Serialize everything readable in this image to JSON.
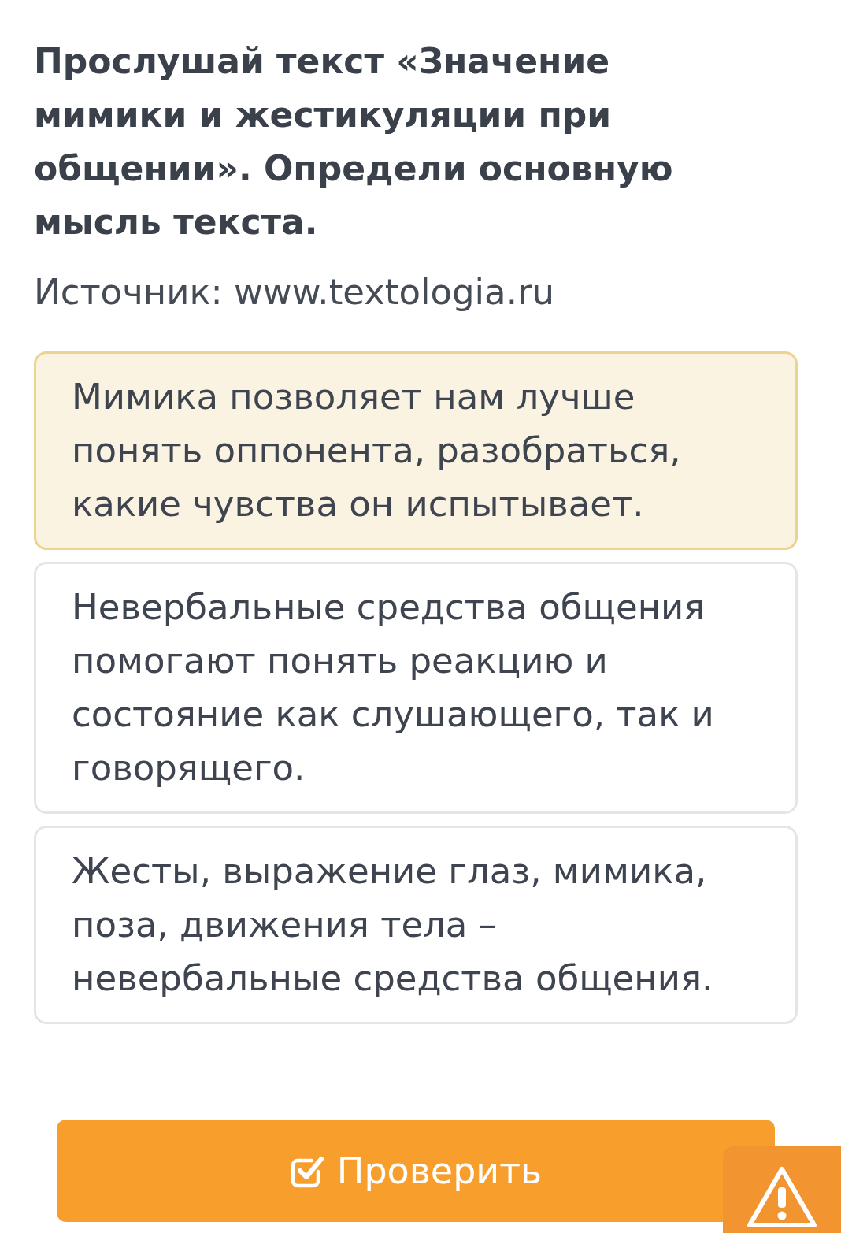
{
  "question": {
    "title": "Прослушай текст «Значение мимики и жестикуляции при общении». Определи основную мысль текста.",
    "source": "Источник: www.textologia.ru"
  },
  "options": [
    {
      "text": "Мимика позволяет нам лучше понять оппонента, разобраться, какие чувства он испытывает.",
      "selected": true
    },
    {
      "text": "Невербальные средства общения помогают понять реакцию и состояние как слушающего, так и говорящего.",
      "selected": false
    },
    {
      "text": "Жесты, выражение глаз, мимика, поза, движения тела – невербальные средства общения.",
      "selected": false
    }
  ],
  "check_button": {
    "label": "Проверить"
  }
}
